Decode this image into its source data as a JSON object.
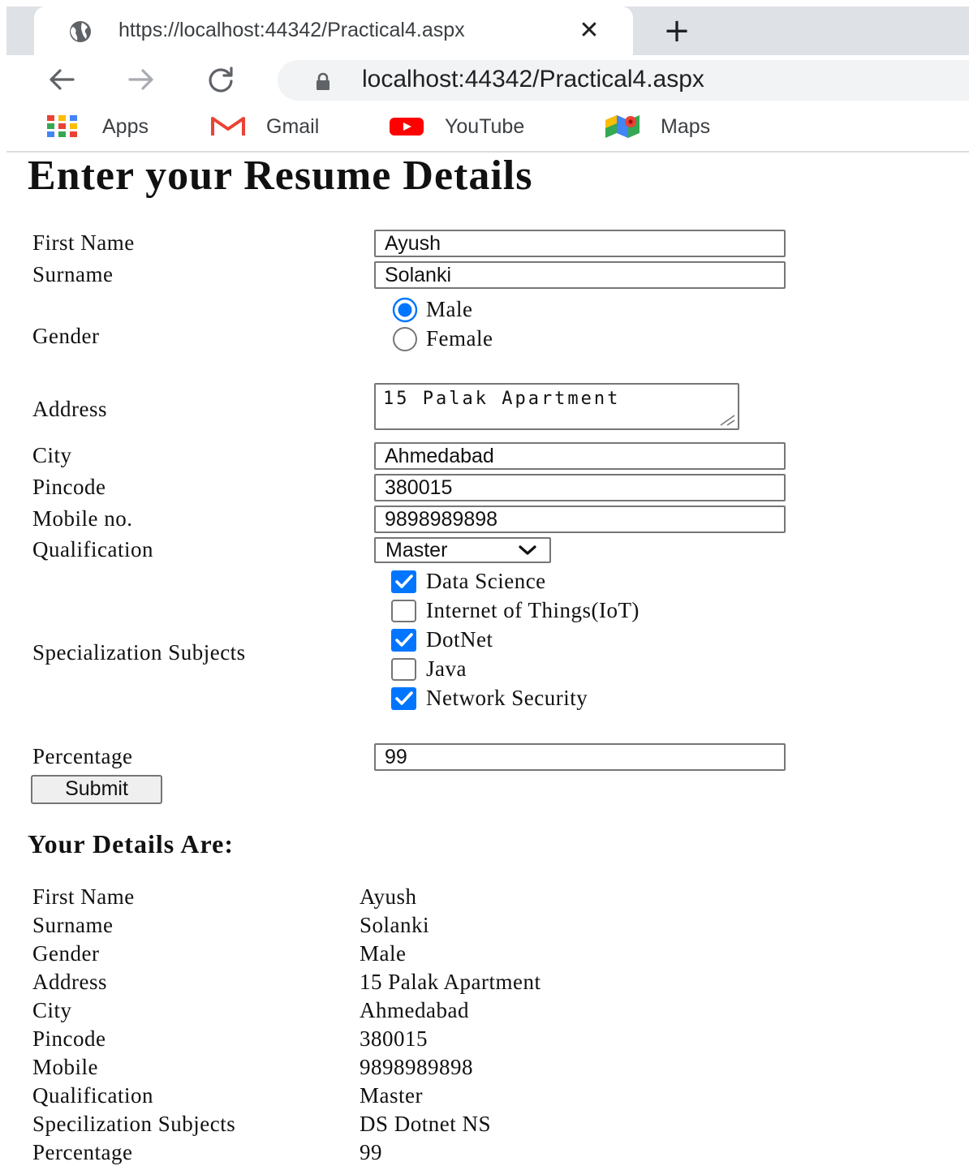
{
  "browser": {
    "tab_title": "https://localhost:44342/Practical4.aspx",
    "tab_close": "✕",
    "new_tab": "+",
    "url": "localhost:44342/Practical4.aspx",
    "bookmarks": [
      {
        "label": "Apps",
        "icon": "apps-grid-icon"
      },
      {
        "label": "Gmail",
        "icon": "gmail-icon"
      },
      {
        "label": "YouTube",
        "icon": "youtube-icon"
      },
      {
        "label": "Maps",
        "icon": "maps-icon"
      }
    ]
  },
  "form": {
    "heading": "Enter your Resume Details",
    "first_name_label": "First Name",
    "first_name_value": "Ayush",
    "surname_label": "Surname",
    "surname_value": "Solanki",
    "gender_label": "Gender",
    "gender_options": [
      {
        "label": "Male",
        "checked": true
      },
      {
        "label": "Female",
        "checked": false
      }
    ],
    "address_label": "Address",
    "address_value": "15 Palak Apartment",
    "city_label": "City",
    "city_value": "Ahmedabad",
    "pincode_label": "Pincode",
    "pincode_value": "380015",
    "mobile_label": "Mobile no.",
    "mobile_value": "9898989898",
    "qualification_label": "Qualification",
    "qualification_value": "Master",
    "specialization_label": "Specialization Subjects",
    "subjects": [
      {
        "label": "Data Science",
        "checked": true
      },
      {
        "label": "Internet of Things(IoT)",
        "checked": false
      },
      {
        "label": "DotNet",
        "checked": true
      },
      {
        "label": "Java",
        "checked": false
      },
      {
        "label": "Network Security",
        "checked": true
      }
    ],
    "percentage_label": "Percentage",
    "percentage_value": "99",
    "submit_label": "Submit"
  },
  "details": {
    "heading": "Your Details Are:",
    "rows": [
      {
        "label": "First Name",
        "value": "Ayush"
      },
      {
        "label": "Surname",
        "value": "Solanki"
      },
      {
        "label": "Gender",
        "value": "Male"
      },
      {
        "label": "Address",
        "value": "15 Palak Apartment"
      },
      {
        "label": "City",
        "value": "Ahmedabad"
      },
      {
        "label": "Pincode",
        "value": "380015"
      },
      {
        "label": "Mobile",
        "value": "9898989898"
      },
      {
        "label": "Qualification",
        "value": "Master"
      },
      {
        "label": "Specilization Subjects",
        "value": "DS Dotnet NS"
      },
      {
        "label": "Percentage",
        "value": "99"
      }
    ]
  },
  "colors": {
    "accent": "#1a73e8",
    "checkbox_blue": "#0075ff",
    "chrome_bg": "#dee1e6",
    "omnibox_bg": "#f1f3f4"
  }
}
